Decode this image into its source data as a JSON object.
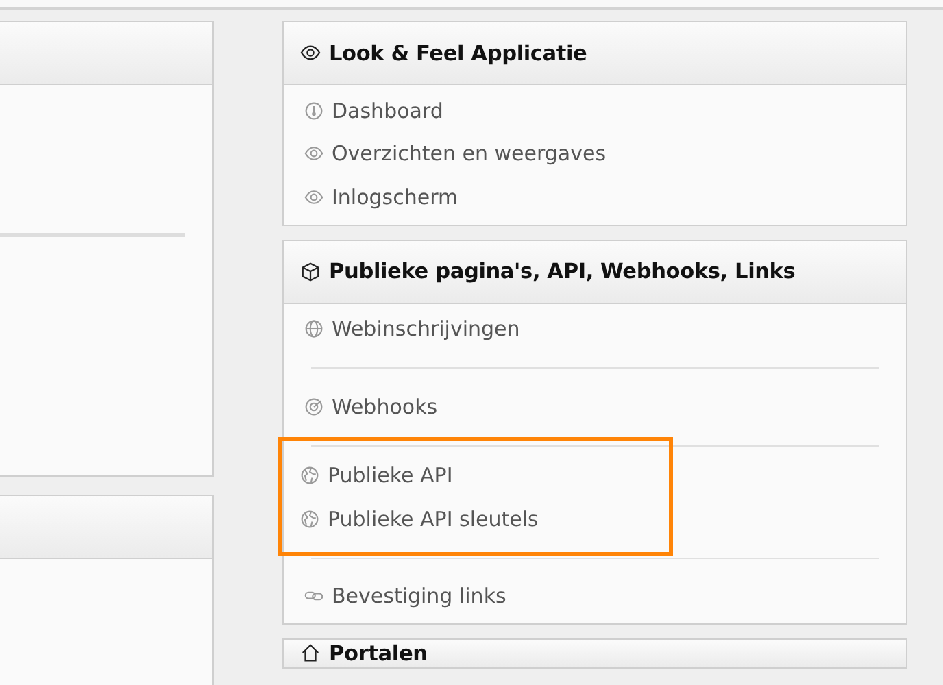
{
  "panels": [
    {
      "title": "Look & Feel Applicatie",
      "groups": [
        {
          "highlighted": false,
          "items": [
            {
              "label": "Dashboard"
            },
            {
              "label": "Overzichten en weergaves"
            },
            {
              "label": "Inlogscherm"
            }
          ]
        }
      ]
    },
    {
      "title": "Publieke pagina's, API, Webhooks, Links",
      "groups": [
        {
          "highlighted": false,
          "items": [
            {
              "label": "Webinschrijvingen"
            }
          ]
        },
        {
          "highlighted": false,
          "items": [
            {
              "label": "Webhooks"
            }
          ]
        },
        {
          "highlighted": true,
          "items": [
            {
              "label": "Publieke API"
            },
            {
              "label": "Publieke API sleutels"
            }
          ]
        },
        {
          "highlighted": false,
          "items": [
            {
              "label": "Bevestiging links"
            }
          ]
        }
      ]
    },
    {
      "title": "Portalen"
    }
  ]
}
